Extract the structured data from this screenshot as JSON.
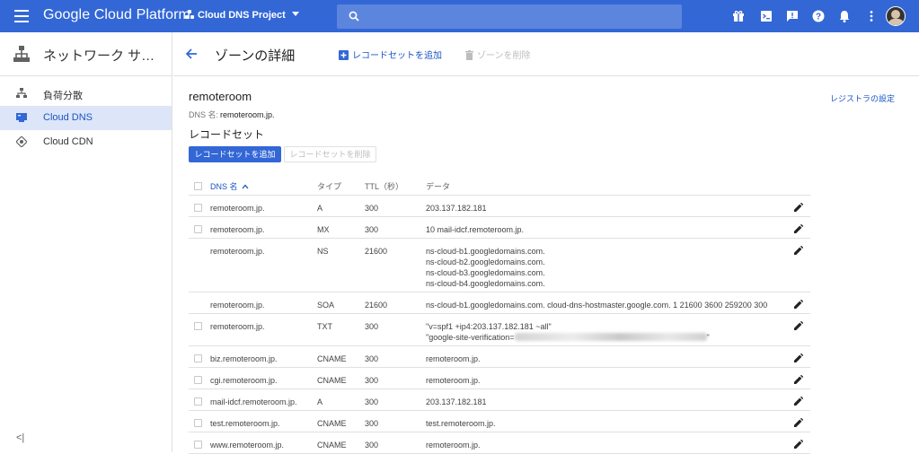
{
  "topbar": {
    "brand": "Google Cloud Platform",
    "project": "Cloud DNS Project",
    "search_placeholder": "",
    "colors": {
      "bar": "#3367d6",
      "search": "#5c85de"
    },
    "icons": [
      "gift-icon",
      "terminal-icon",
      "feedback-icon",
      "help-icon",
      "notifications-icon",
      "more-vert-icon"
    ]
  },
  "sidebar": {
    "title": "ネットワーク サ…",
    "items": [
      {
        "label": "負荷分散",
        "icon": "load-balancing-icon",
        "active": false
      },
      {
        "label": "Cloud DNS",
        "icon": "cloud-dns-icon",
        "active": true
      },
      {
        "label": "Cloud CDN",
        "icon": "cloud-cdn-icon",
        "active": false
      }
    ],
    "collapse_label": "<|"
  },
  "header": {
    "title": "ゾーンの詳細",
    "add_recordset": "レコードセットを追加",
    "delete_zone": "ゾーンを削除"
  },
  "zone": {
    "name": "remoteroom",
    "dns_label": "DNS 名:",
    "dns_value": "remoteroom.jp.",
    "registrar_link": "レジストラの設定"
  },
  "recordsets": {
    "title": "レコードセット",
    "add_button": "レコードセットを追加",
    "delete_button": "レコードセットを削除",
    "columns": {
      "name": "DNS 名",
      "type": "タイプ",
      "ttl": "TTL（秒）",
      "data": "データ"
    },
    "rows": [
      {
        "name": "remoteroom.jp.",
        "type": "A",
        "ttl": "300",
        "data": [
          "203.137.182.181"
        ],
        "checkbox": true
      },
      {
        "name": "remoteroom.jp.",
        "type": "MX",
        "ttl": "300",
        "data": [
          "10 mail-idcf.remoteroom.jp."
        ],
        "checkbox": true
      },
      {
        "name": "remoteroom.jp.",
        "type": "NS",
        "ttl": "21600",
        "data": [
          "ns-cloud-b1.googledomains.com.",
          "ns-cloud-b2.googledomains.com.",
          "ns-cloud-b3.googledomains.com.",
          "ns-cloud-b4.googledomains.com."
        ],
        "checkbox": false
      },
      {
        "name": "remoteroom.jp.",
        "type": "SOA",
        "ttl": "21600",
        "data": [
          "ns-cloud-b1.googledomains.com. cloud-dns-hostmaster.google.com. 1 21600 3600 259200 300"
        ],
        "checkbox": false
      },
      {
        "name": "remoteroom.jp.",
        "type": "TXT",
        "ttl": "300",
        "data": [
          "\"v=spf1 +ip4:203.137.182.181 ~all\"",
          "\"google-site-verification="
        ],
        "checkbox": true,
        "blurred": true
      },
      {
        "name": "biz.remoteroom.jp.",
        "type": "CNAME",
        "ttl": "300",
        "data": [
          "remoteroom.jp."
        ],
        "checkbox": true
      },
      {
        "name": "cgi.remoteroom.jp.",
        "type": "CNAME",
        "ttl": "300",
        "data": [
          "remoteroom.jp."
        ],
        "checkbox": true
      },
      {
        "name": "mail-idcf.remoteroom.jp.",
        "type": "A",
        "ttl": "300",
        "data": [
          "203.137.182.181"
        ],
        "checkbox": true
      },
      {
        "name": "test.remoteroom.jp.",
        "type": "CNAME",
        "ttl": "300",
        "data": [
          "test.remoteroom.jp."
        ],
        "checkbox": true
      },
      {
        "name": "www.remoteroom.jp.",
        "type": "CNAME",
        "ttl": "300",
        "data": [
          "remoteroom.jp."
        ],
        "checkbox": true
      }
    ]
  }
}
